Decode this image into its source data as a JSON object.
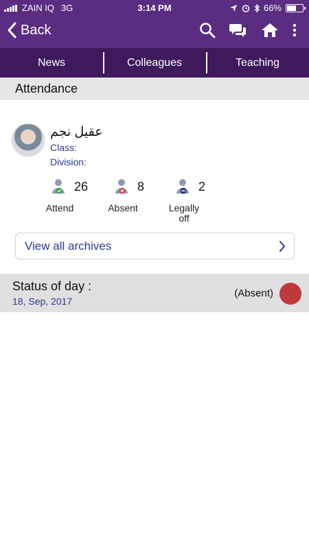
{
  "status_bar": {
    "carrier": "ZAIN IQ",
    "network": "3G",
    "time": "3:14 PM",
    "battery": "66%",
    "battery_level": 0.66
  },
  "nav": {
    "back_label": "Back",
    "icons": [
      "search-icon",
      "chat-icon",
      "home-icon",
      "more-vert-icon"
    ]
  },
  "tabs": [
    {
      "label": "News"
    },
    {
      "label": "Colleagues"
    },
    {
      "label": "Teaching"
    }
  ],
  "section": {
    "title": "Attendance"
  },
  "student": {
    "name": "عقيل نجم",
    "class_label": "Class:",
    "division_label": "Division:"
  },
  "stats": [
    {
      "label": "Attend",
      "count": "26",
      "badge_color": "#3aa845"
    },
    {
      "label": "Absent",
      "count": "8",
      "badge_color": "#d63b3b"
    },
    {
      "label": "Legally\noff",
      "count": "2",
      "badge_color": "#2a3a8c"
    }
  ],
  "archives": {
    "label": "View all archives"
  },
  "day_status": {
    "title": "Status of day :",
    "date": "18, Sep, 2017",
    "value": "(Absent)",
    "indicator_color": "#c0393b"
  },
  "colors": {
    "primary": "#5a2d82",
    "tab_bar": "#3e1a5c",
    "link": "#2a3a8c"
  }
}
